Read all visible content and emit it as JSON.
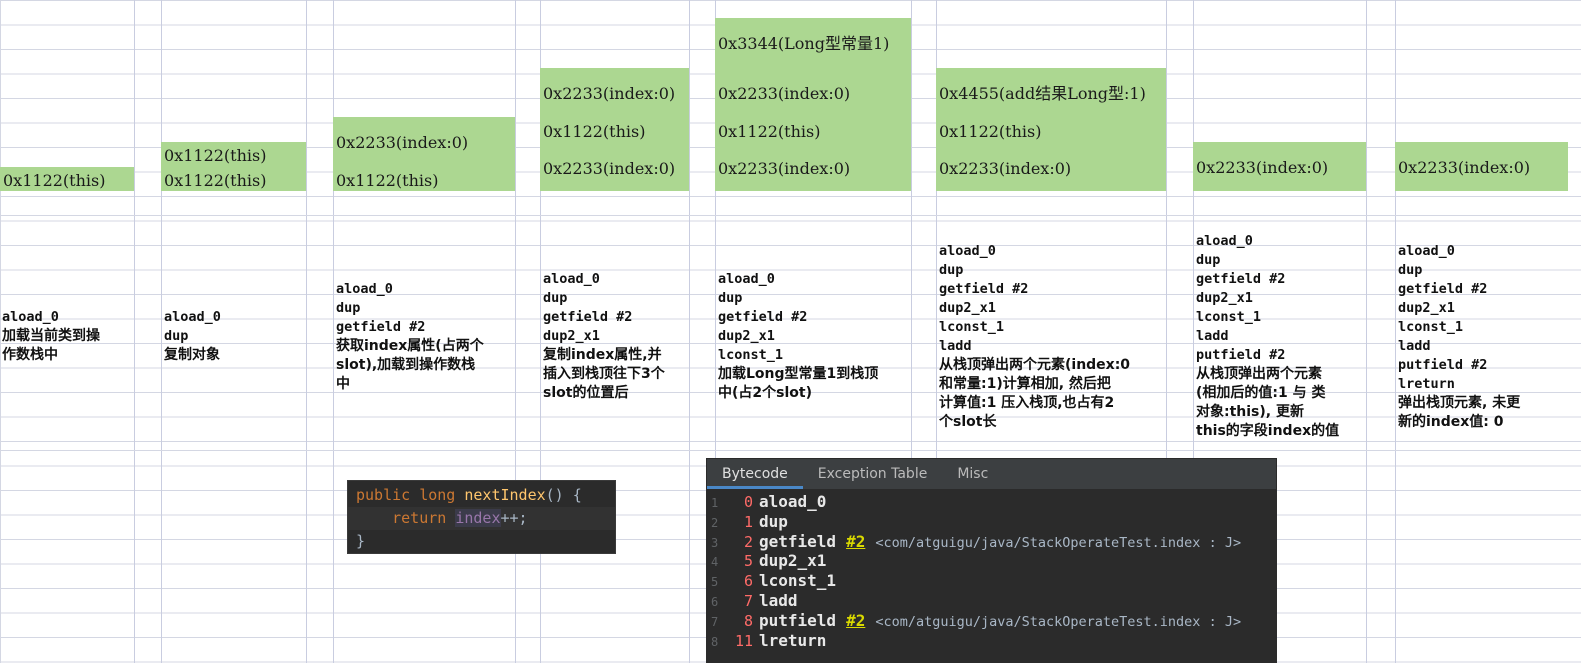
{
  "stack_columns": [
    {
      "id": "c1",
      "cells": [
        "0x1122(this)"
      ],
      "desc_code": [
        "aload_0"
      ],
      "desc_text": "加载当前类到操\n作数栈中"
    },
    {
      "id": "c2",
      "cells": [
        "0x1122(this)",
        "0x1122(this)"
      ],
      "desc_code": [
        "aload_0",
        "dup"
      ],
      "desc_text": "复制对象"
    },
    {
      "id": "c3",
      "cells": [
        "0x2233(index:0)",
        "0x1122(this)"
      ],
      "desc_code": [
        "aload_0",
        "dup",
        "getfield #2"
      ],
      "desc_text": "获取index属性(占两个\nslot),加载到操作数栈\n中"
    },
    {
      "id": "c4",
      "cells": [
        "0x2233(index:0)",
        "0x1122(this)",
        "0x2233(index:0)"
      ],
      "desc_code": [
        "aload_0",
        "dup",
        "getfield #2",
        "dup2_x1"
      ],
      "desc_text": "复制index属性,并\n插入到栈顶往下3个\nslot的位置后"
    },
    {
      "id": "c5",
      "cells": [
        "0x3344(Long型常量1)",
        "0x2233(index:0)",
        "0x1122(this)",
        "0x2233(index:0)"
      ],
      "desc_code": [
        "aload_0",
        "dup",
        "getfield #2",
        "dup2_x1",
        "lconst_1"
      ],
      "desc_text": "加载Long型常量1到栈顶\n中(占2个slot)"
    },
    {
      "id": "c6",
      "cells": [
        "0x4455(add结果Long型:1)",
        "0x1122(this)",
        "0x2233(index:0)"
      ],
      "desc_code": [
        "aload_0",
        "dup",
        "getfield #2",
        "dup2_x1",
        "lconst_1",
        "ladd"
      ],
      "desc_text": "从栈顶弹出两个元素(index:0\n和常量:1)计算相加, 然后把\n计算值:1 压入栈顶,也占有2\n个slot长"
    },
    {
      "id": "c7",
      "cells": [
        "0x2233(index:0)"
      ],
      "desc_code": [
        "aload_0",
        "dup",
        "getfield #2",
        "dup2_x1",
        "lconst_1",
        "ladd",
        "putfield #2"
      ],
      "desc_text": "从栈顶弹出两个元素\n(相加后的值:1 与 类\n对象:this), 更新\nthis的字段index的值"
    },
    {
      "id": "c8",
      "cells": [
        "0x2233(index:0)"
      ],
      "desc_code": [
        "aload_0",
        "dup",
        "getfield #2",
        "dup2_x1",
        "lconst_1",
        "ladd",
        "putfield #2",
        "lreturn"
      ],
      "desc_text": "弹出栈顶元素, 未更\n新的index值: 0"
    }
  ],
  "code_snippet": {
    "line1": {
      "kw1": "public",
      "kw2": "long",
      "fn": "nextIndex",
      "rest": "() {"
    },
    "line2": {
      "kw": "return",
      "field": "index",
      "rest": "++;"
    },
    "line3": "}"
  },
  "bytecode_panel": {
    "tabs": [
      "Bytecode",
      "Exception Table",
      "Misc"
    ],
    "active_tab": "Bytecode",
    "rows": [
      {
        "ln": "1",
        "off": "0",
        "op": "aload_0",
        "ref": "",
        "cmt": ""
      },
      {
        "ln": "2",
        "off": "1",
        "op": "dup",
        "ref": "",
        "cmt": ""
      },
      {
        "ln": "3",
        "off": "2",
        "op": "getfield",
        "ref": "#2",
        "cmt": "<com/atguigu/java/StackOperateTest.index : J>"
      },
      {
        "ln": "4",
        "off": "5",
        "op": "dup2_x1",
        "ref": "",
        "cmt": ""
      },
      {
        "ln": "5",
        "off": "6",
        "op": "lconst_1",
        "ref": "",
        "cmt": ""
      },
      {
        "ln": "6",
        "off": "7",
        "op": "ladd",
        "ref": "",
        "cmt": ""
      },
      {
        "ln": "7",
        "off": "8",
        "op": "putfield",
        "ref": "#2",
        "cmt": "<com/atguigu/java/StackOperateTest.index : J>"
      },
      {
        "ln": "8",
        "off": "11",
        "op": "lreturn",
        "ref": "",
        "cmt": ""
      }
    ]
  },
  "colors": {
    "stack_fill": "#acd791",
    "code_bg": "#2b2b2b",
    "panel_bg": "#3c3f41",
    "offset": "#ff6b68",
    "ref": "#d9d900"
  }
}
